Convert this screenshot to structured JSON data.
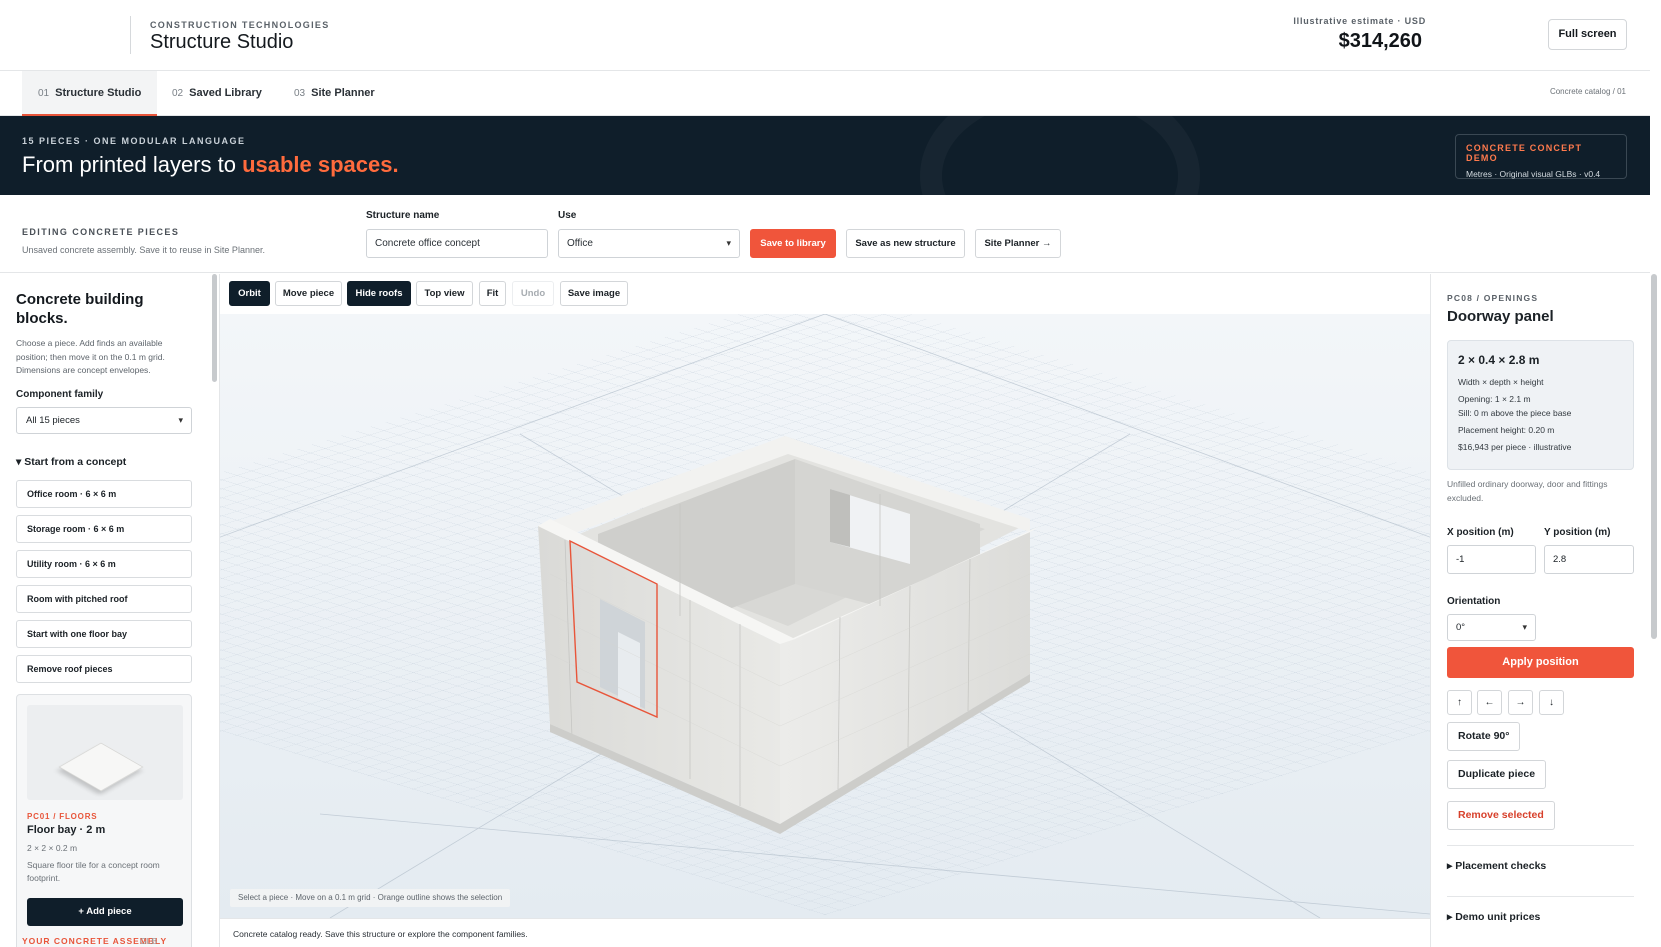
{
  "header": {
    "eyebrow": "CONSTRUCTION TECHNOLOGIES",
    "title": "Structure Studio",
    "estimate_label": "Illustrative estimate · USD",
    "estimate_value": "$314,260",
    "fullscreen_label": "Full screen"
  },
  "tabs": [
    {
      "num": "01",
      "label": "Structure Studio",
      "active": true
    },
    {
      "num": "02",
      "label": "Saved Library",
      "active": false
    },
    {
      "num": "03",
      "label": "Site Planner",
      "active": false
    }
  ],
  "catalog_ref": "Concrete catalog / 01",
  "hero": {
    "eyebrow": "15 PIECES · ONE MODULAR LANGUAGE",
    "title_plain": "From printed layers to ",
    "title_accent": "usable spaces.",
    "demo_title": "CONCRETE CONCEPT DEMO",
    "demo_sub": "Metres · Original visual GLBs · v0.4"
  },
  "editbar": {
    "eyebrow": "EDITING CONCRETE PIECES",
    "sub": "Unsaved concrete assembly.  Save it to reuse in Site Planner.",
    "name_label": "Structure name",
    "name_value": "Concrete office concept",
    "use_label": "Use",
    "use_value": "Office",
    "save_label": "Save to library",
    "save_new_label": "Save as new structure",
    "site_planner_label": "Site Planner →"
  },
  "left": {
    "title": "Concrete building blocks.",
    "desc": "Choose a piece. Add finds an available position; then move it on the 0.1 m grid. Dimensions are concept envelopes.",
    "family_label": "Component family",
    "family_value": "All 15 pieces",
    "concept_head": "▾ Start from a concept",
    "concepts": [
      "Office room · 6 × 6 m",
      "Storage room · 6 × 6 m",
      "Utility room · 6 × 6 m",
      "Room with pitched roof",
      "Start with one floor bay",
      "Remove roof pieces"
    ],
    "card": {
      "eyebrow": "PC01 / FLOORS",
      "title": "Floor bay · 2 m",
      "dims": "2 × 2 × 0.2 m",
      "desc": "Square floor tile for a concept room footprint.",
      "add": "+ Add piece"
    },
    "footer": "YOUR CONCRETE ASSEMBLY",
    "footer_glb": "GLB"
  },
  "viewer": {
    "tools": [
      {
        "label": "Orbit",
        "state": "active"
      },
      {
        "label": "Move piece",
        "state": "normal"
      },
      {
        "label": "Hide roofs",
        "state": "active"
      },
      {
        "label": "Top view",
        "state": "normal"
      },
      {
        "label": "Fit",
        "state": "normal"
      },
      {
        "label": "Undo",
        "state": "disabled"
      },
      {
        "label": "Save image",
        "state": "normal"
      }
    ],
    "hint": "Select a piece · Move on a 0.1 m grid · Orange outline shows the selection",
    "status": "Concrete catalog ready. Save this structure or explore the component families."
  },
  "inspector": {
    "eyebrow": "PC08 / OPENINGS",
    "title": "Doorway panel",
    "dims": "2 × 0.4 × 2.8 m",
    "lines": [
      "Width × depth × height",
      "Opening: 1 × 2.1 m",
      "Sill: 0 m above the piece base",
      "Placement height: 0.20 m",
      "$16,943 per piece · illustrative"
    ],
    "note": "Unfilled ordinary doorway, door and fittings excluded.",
    "x_label": "X position (m)",
    "x_value": "-1",
    "y_label": "Y position (m)",
    "y_value": "2.8",
    "orientation_label": "Orientation",
    "orientation_value": "0°",
    "apply": "Apply position",
    "nudges": [
      "↑",
      "←",
      "→",
      "↓"
    ],
    "rotate": "Rotate 90°",
    "duplicate": "Duplicate piece",
    "remove": "Remove selected",
    "checks": "▸ Placement checks",
    "prices": "▸ Demo unit prices"
  },
  "colors": {
    "accent": "#f0553b",
    "navy": "#0f1e2a",
    "selection": "#e8553a"
  }
}
